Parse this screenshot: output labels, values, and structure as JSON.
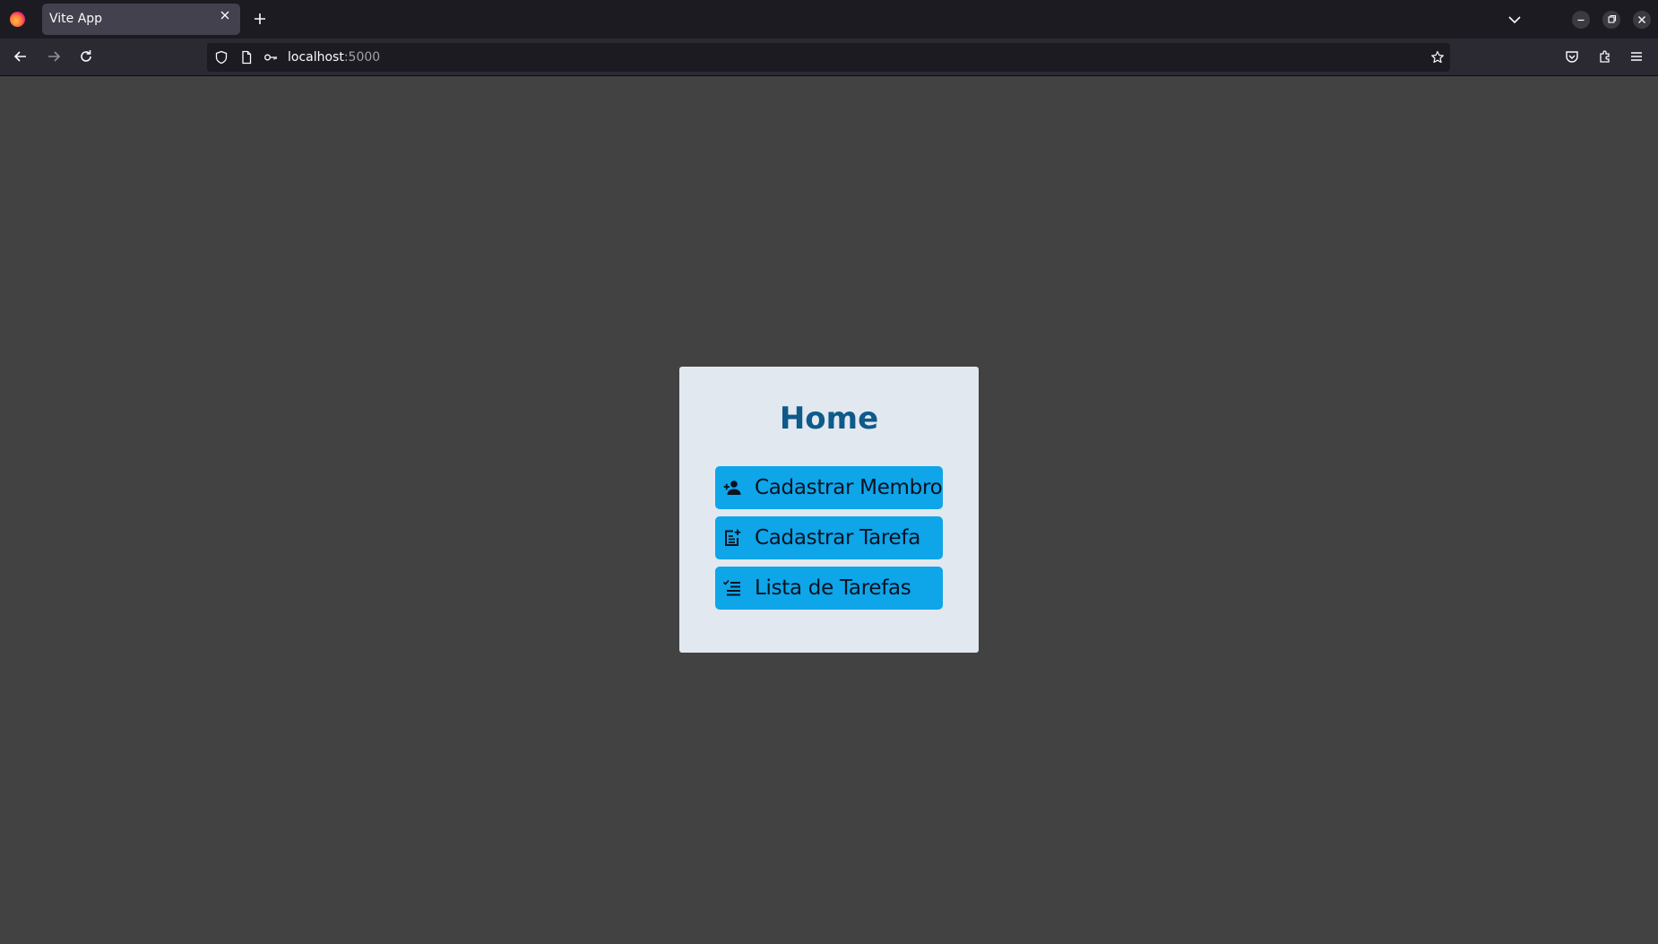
{
  "browser": {
    "tab_title": "Vite App",
    "url_host": "localhost",
    "url_port": ":5000"
  },
  "page": {
    "title": "Home",
    "buttons": [
      {
        "label": "Cadastrar Membro",
        "icon": "person-add-icon"
      },
      {
        "label": "Cadastrar Tarefa",
        "icon": "note-add-icon"
      },
      {
        "label": "Lista de Tarefas",
        "icon": "checklist-icon"
      }
    ]
  },
  "colors": {
    "page_background": "#424242",
    "card_background": "#e2e8f0",
    "title_color": "#0e5a8a",
    "button_background": "#0ea5e9"
  }
}
